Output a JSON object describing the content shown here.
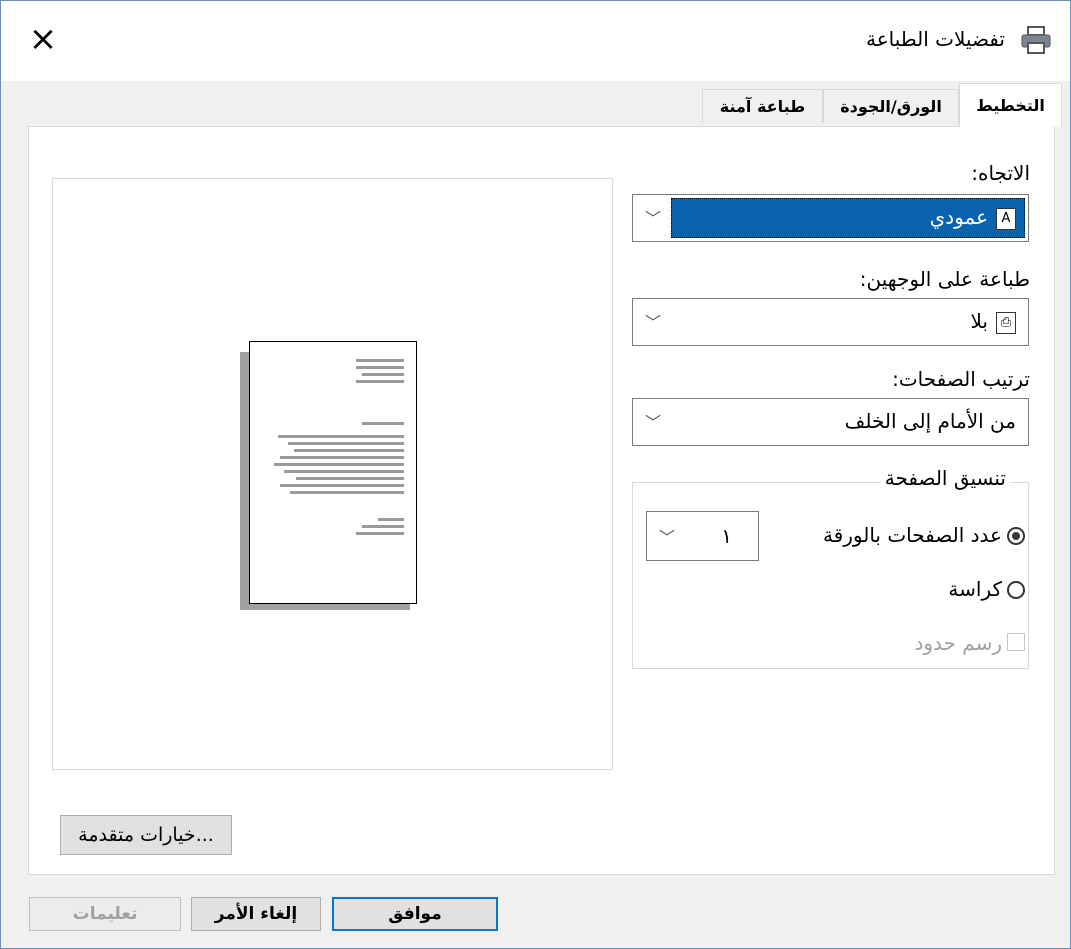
{
  "window": {
    "title": "تفضيلات الطباعة"
  },
  "tabs": [
    "التخطيط",
    "الورق/الجودة",
    "طباعة آمنة"
  ],
  "layout": {
    "orientation": {
      "label": "الاتجاه:",
      "value": "عمودي",
      "icon_text": "A"
    },
    "duplex": {
      "label": "طباعة على الوجهين:",
      "value": "بلا"
    },
    "page_order": {
      "label": "ترتيب الصفحات:",
      "value": "من الأمام إلى الخلف"
    },
    "page_format": {
      "group_label": "تنسيق الصفحة",
      "pages_per_sheet": {
        "label": "عدد الصفحات بالورقة",
        "value": "١",
        "selected": true
      },
      "booklet": {
        "label": "كراسة",
        "selected": false
      },
      "draw_borders": {
        "label": "رسم حدود",
        "checked": false,
        "enabled": false
      }
    },
    "advanced_button": "خيارات متقدمة..."
  },
  "footer": {
    "ok": "موافق",
    "cancel": "إلغاء الأمر",
    "help": "تعليمات"
  },
  "colors": {
    "accent": "#0078d7",
    "selection": "#0a64ad"
  },
  "icons": [
    "printer-icon",
    "close-icon",
    "chevron-down-icon",
    "orientation-icon",
    "duplex-icon"
  ]
}
